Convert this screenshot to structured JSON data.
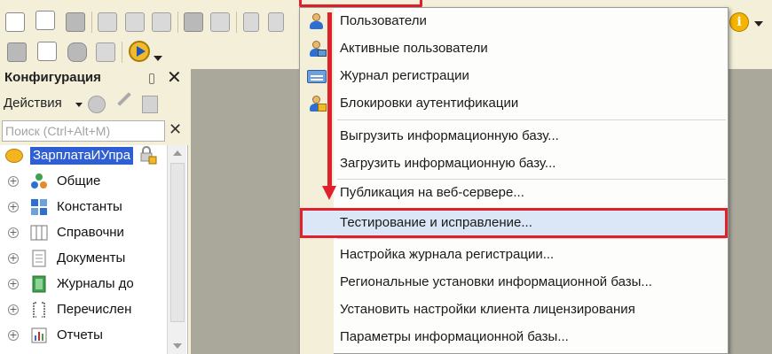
{
  "panel": {
    "title": "Конфигурация",
    "actions_label": "Действия",
    "search_placeholder": "Поиск (Ctrl+Alt+M)",
    "root": {
      "label": "ЗарплатаИУпра"
    },
    "tree": [
      {
        "label": "Общие",
        "icon": "common-icon"
      },
      {
        "label": "Константы",
        "icon": "constants-icon"
      },
      {
        "label": "Справочни",
        "icon": "catalogs-icon"
      },
      {
        "label": "Документы",
        "icon": "documents-icon"
      },
      {
        "label": "Журналы до",
        "icon": "journals-icon"
      },
      {
        "label": "Перечислен",
        "icon": "enums-icon"
      },
      {
        "label": "Отчеты",
        "icon": "reports-icon"
      }
    ]
  },
  "toolbar": {
    "info_label": "i"
  },
  "menu": {
    "items": [
      {
        "label": "Пользователи",
        "icon": "user-icon"
      },
      {
        "label": "Активные пользователи",
        "icon": "active-users-icon"
      },
      {
        "label": "Журнал регистрации",
        "icon": "event-log-icon"
      },
      {
        "label": "Блокировки аутентификации",
        "icon": "auth-lock-icon"
      },
      {
        "label": "Выгрузить информационную базу...",
        "icon": ""
      },
      {
        "label": "Загрузить информационную базу...",
        "icon": ""
      },
      {
        "label": "Публикация на веб-сервере...",
        "icon": ""
      },
      {
        "label": "Тестирование и исправление...",
        "icon": "",
        "highlighted": true
      },
      {
        "label": "Настройка журнала регистрации...",
        "icon": ""
      },
      {
        "label": "Региональные установки информационной базы...",
        "icon": ""
      },
      {
        "label": "Установить настройки клиента лицензирования",
        "icon": ""
      },
      {
        "label": "Параметры информационной базы...",
        "icon": ""
      }
    ]
  },
  "colors": {
    "accent_red": "#e0202a",
    "selection_blue": "#2f5fd3",
    "menu_hover": "#dbe6f6",
    "chrome_beige": "#f3efd9",
    "workspace_gray": "#aaa79b"
  }
}
